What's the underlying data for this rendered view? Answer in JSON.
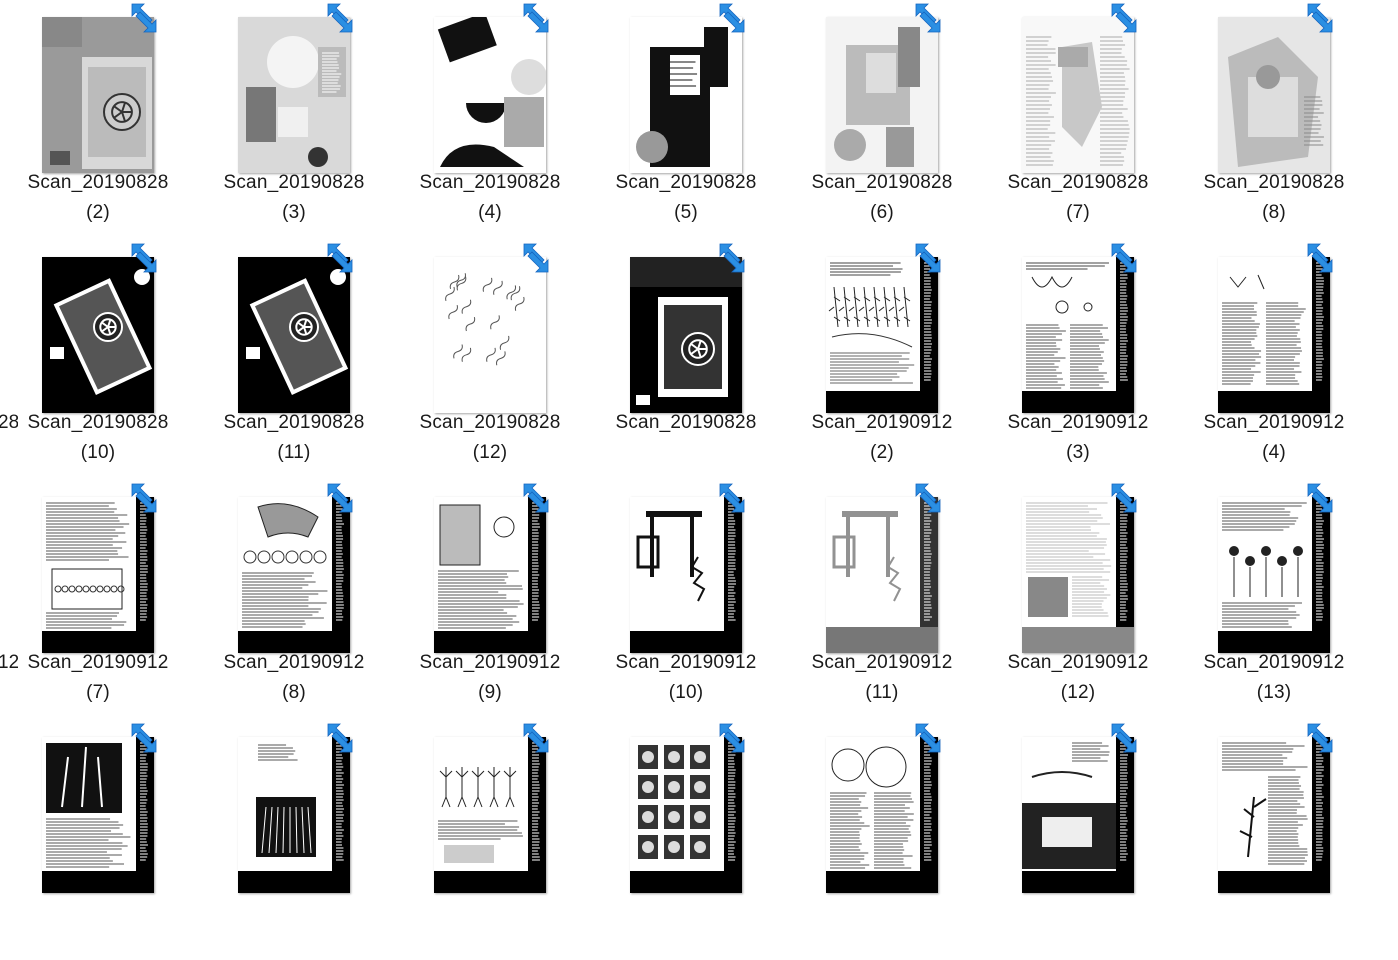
{
  "colors": {
    "sync_accent": "#2b8fe3",
    "sync_accent_dark": "#1565c0",
    "label_text": "#1a1a1a"
  },
  "icons": {
    "sync_overlay": "shortcut-arrow-icon"
  },
  "edge_labels": [
    "",
    "28",
    "12",
    ""
  ],
  "rows": [
    [
      {
        "name_line1": "Scan_20190828",
        "name_line2": "(2)",
        "style": "gray-wheel"
      },
      {
        "name_line1": "Scan_20190828",
        "name_line2": "(3)",
        "style": "collage-light"
      },
      {
        "name_line1": "Scan_20190828",
        "name_line2": "(4)",
        "style": "bw-shapes"
      },
      {
        "name_line1": "Scan_20190828",
        "name_line2": "(5)",
        "style": "bw-window"
      },
      {
        "name_line1": "Scan_20190828",
        "name_line2": "(6)",
        "style": "light-window"
      },
      {
        "name_line1": "Scan_20190828",
        "name_line2": "(7)",
        "style": "light-text-figure"
      },
      {
        "name_line1": "Scan_20190828",
        "name_line2": "(8)",
        "style": "light-figure"
      }
    ],
    [
      {
        "name_line1": "Scan_20190828",
        "name_line2": "(10)",
        "style": "dark-wheel"
      },
      {
        "name_line1": "Scan_20190828",
        "name_line2": "(11)",
        "style": "dark-wheel2"
      },
      {
        "name_line1": "Scan_20190828",
        "name_line2": "(12)",
        "style": "handwriting"
      },
      {
        "name_line1": "Scan_20190828",
        "name_line2": "",
        "style": "dark-wheel3"
      },
      {
        "name_line1": "Scan_20190912",
        "name_line2": "(2)",
        "style": "book-plants"
      },
      {
        "name_line1": "Scan_20190912",
        "name_line2": "(3)",
        "style": "book-coils"
      },
      {
        "name_line1": "Scan_20190912",
        "name_line2": "(4)",
        "style": "book-text"
      }
    ],
    [
      {
        "name_line1": "Scan_20190912",
        "name_line2": "(7)",
        "style": "book-cells"
      },
      {
        "name_line1": "Scan_20190912",
        "name_line2": "(8)",
        "style": "book-section"
      },
      {
        "name_line1": "Scan_20190912",
        "name_line2": "(9)",
        "style": "book-section2"
      },
      {
        "name_line1": "Scan_20190912",
        "name_line2": "(10)",
        "style": "book-press"
      },
      {
        "name_line1": "Scan_20190912",
        "name_line2": "(11)",
        "style": "book-press-gray"
      },
      {
        "name_line1": "Scan_20190912",
        "name_line2": "(12)",
        "style": "book-photo-gray"
      },
      {
        "name_line1": "Scan_20190912",
        "name_line2": "(13)",
        "style": "book-flowers"
      }
    ],
    [
      {
        "name_line1": "",
        "name_line2": "",
        "style": "book-plant-photo"
      },
      {
        "name_line1": "",
        "name_line2": "",
        "style": "book-roots"
      },
      {
        "name_line1": "",
        "name_line2": "",
        "style": "book-seedlings"
      },
      {
        "name_line1": "",
        "name_line2": "",
        "style": "book-grid"
      },
      {
        "name_line1": "",
        "name_line2": "",
        "style": "book-circles"
      },
      {
        "name_line1": "",
        "name_line2": "",
        "style": "book-title-photo"
      },
      {
        "name_line1": "",
        "name_line2": "",
        "style": "book-plant2"
      }
    ]
  ]
}
